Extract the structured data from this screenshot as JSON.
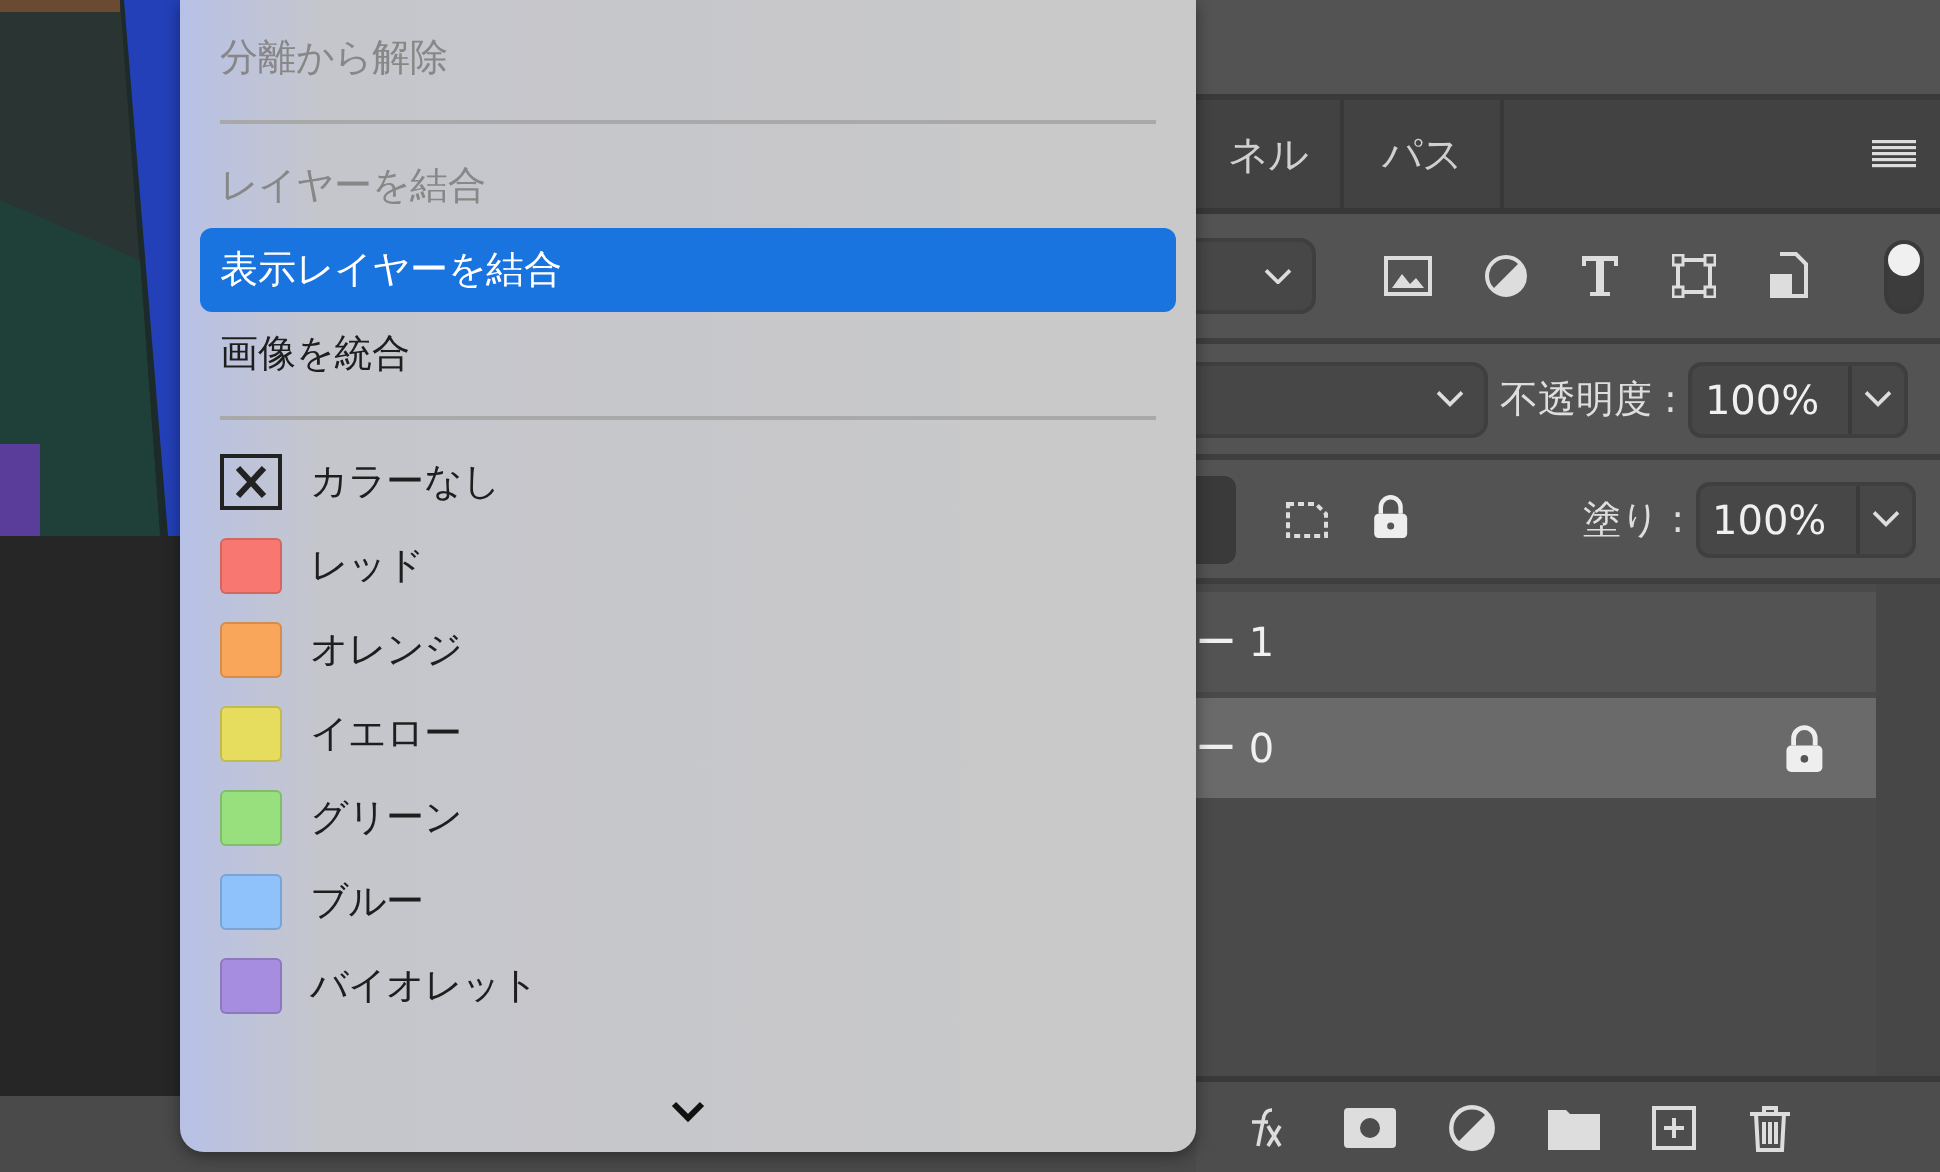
{
  "menu": {
    "items": [
      {
        "kind": "item",
        "label": "分離から解除",
        "disabled": true,
        "selected": false
      },
      {
        "kind": "separator"
      },
      {
        "kind": "item",
        "label": "レイヤーを結合",
        "disabled": true,
        "selected": false
      },
      {
        "kind": "item",
        "label": "表示レイヤーを結合",
        "disabled": false,
        "selected": true
      },
      {
        "kind": "item",
        "label": "画像を統合",
        "disabled": false,
        "selected": false
      },
      {
        "kind": "separator"
      },
      {
        "kind": "none",
        "label": "カラーなし"
      },
      {
        "kind": "color",
        "label": "レッド",
        "color": "#f87871"
      },
      {
        "kind": "color",
        "label": "オレンジ",
        "color": "#f9a65a"
      },
      {
        "kind": "color",
        "label": "イエロー",
        "color": "#e6dc5e"
      },
      {
        "kind": "color",
        "label": "グリーン",
        "color": "#98e07e"
      },
      {
        "kind": "color",
        "label": "ブルー",
        "color": "#8fc1fa"
      },
      {
        "kind": "color",
        "label": "バイオレット",
        "color": "#a68ddf"
      }
    ]
  },
  "panel": {
    "tabs": [
      {
        "label": "ネル",
        "selected": false
      },
      {
        "label": "パス",
        "selected": false
      }
    ],
    "filter_toggle": {
      "on": true
    },
    "opacity": {
      "label": "不透明度 :",
      "value": "100%"
    },
    "fill": {
      "label": "塗り :",
      "value": "100%"
    },
    "layers": [
      {
        "name": "ー 1",
        "selected": false,
        "locked": false
      },
      {
        "name": "ー 0",
        "selected": true,
        "locked": true
      }
    ]
  }
}
